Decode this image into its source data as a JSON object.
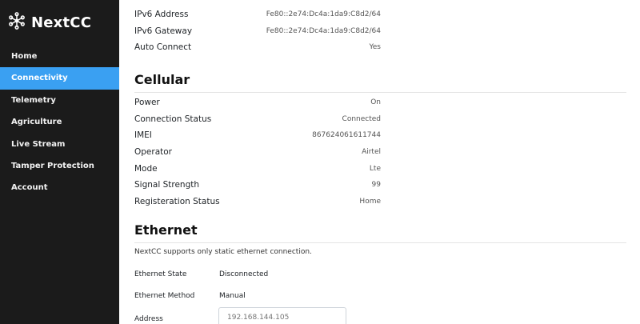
{
  "brand": {
    "name": "NextCC",
    "icon": "network-node-icon"
  },
  "sidebar": {
    "items": [
      {
        "label": "Home",
        "active": false
      },
      {
        "label": "Connectivity",
        "active": true
      },
      {
        "label": "Telemetry",
        "active": false
      },
      {
        "label": "Agriculture",
        "active": false
      },
      {
        "label": "Live Stream",
        "active": false
      },
      {
        "label": "Tamper Protection",
        "active": false
      },
      {
        "label": "Account",
        "active": false
      }
    ]
  },
  "network": {
    "rows": [
      {
        "label": "IPv6 Address",
        "value": "Fe80::2e74:Dc4a:1da9:C8d2/64"
      },
      {
        "label": "IPv6 Gateway",
        "value": "Fe80::2e74:Dc4a:1da9:C8d2/64"
      },
      {
        "label": "Auto Connect",
        "value": "Yes"
      }
    ]
  },
  "cellular": {
    "title": "Cellular",
    "rows": [
      {
        "label": "Power",
        "value": "On"
      },
      {
        "label": "Connection Status",
        "value": "Connected"
      },
      {
        "label": "IMEI",
        "value": "867624061611744"
      },
      {
        "label": "Operator",
        "value": "Airtel"
      },
      {
        "label": "Mode",
        "value": "Lte"
      },
      {
        "label": "Signal Strength",
        "value": "99"
      },
      {
        "label": "Registeration Status",
        "value": "Home"
      }
    ]
  },
  "ethernet": {
    "title": "Ethernet",
    "note": "NextCC supports only static ethernet connection.",
    "state_label": "Ethernet State",
    "state_value": "Disconnected",
    "method_label": "Ethernet Method",
    "method_value": "Manual",
    "address_label": "Address",
    "address_placeholder": "192.168.144.105"
  },
  "colors": {
    "sidebar_bg": "#1b1b1b",
    "active_accent": "#3aa0f2"
  }
}
